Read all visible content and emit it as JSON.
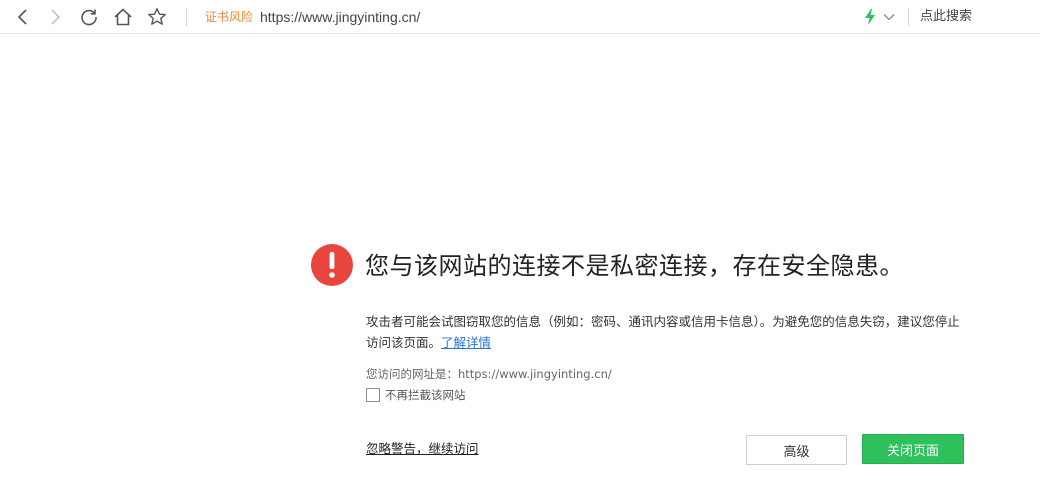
{
  "toolbar": {
    "cert_warning": "证书风险",
    "url": "https://www.jingyinting.cn/",
    "search_hint": "点此搜索"
  },
  "warning": {
    "title": "您与该网站的连接不是私密连接，存在安全隐患。",
    "description": "攻击者可能会试图窃取您的信息（例如：密码、通讯内容或信用卡信息）。为避免您的信息失窃，建议您停止访问该页面。",
    "learn_more": "了解详情",
    "visited_url": "您访问的网址是：https://www.jingyinting.cn/",
    "no_block_label": "不再拦截该网站",
    "ignore_link": "忽略警告，继续访问",
    "advanced_button": "高级",
    "close_page_button": "关闭页面"
  },
  "colors": {
    "cert_warning": "#e9893a",
    "warning_icon": "#e9453f",
    "link": "#2a73d9",
    "primary_button": "#2dc05b",
    "speed_icon": "#2dc05b"
  },
  "icons": {
    "back": "back-arrow-icon",
    "forward": "forward-arrow-icon",
    "reload": "reload-icon",
    "home": "home-icon",
    "favorite": "star-icon",
    "speed": "lightning-icon",
    "dropdown": "chevron-down-icon",
    "warning": "exclamation-circle-icon"
  },
  "checkbox_checked": false
}
